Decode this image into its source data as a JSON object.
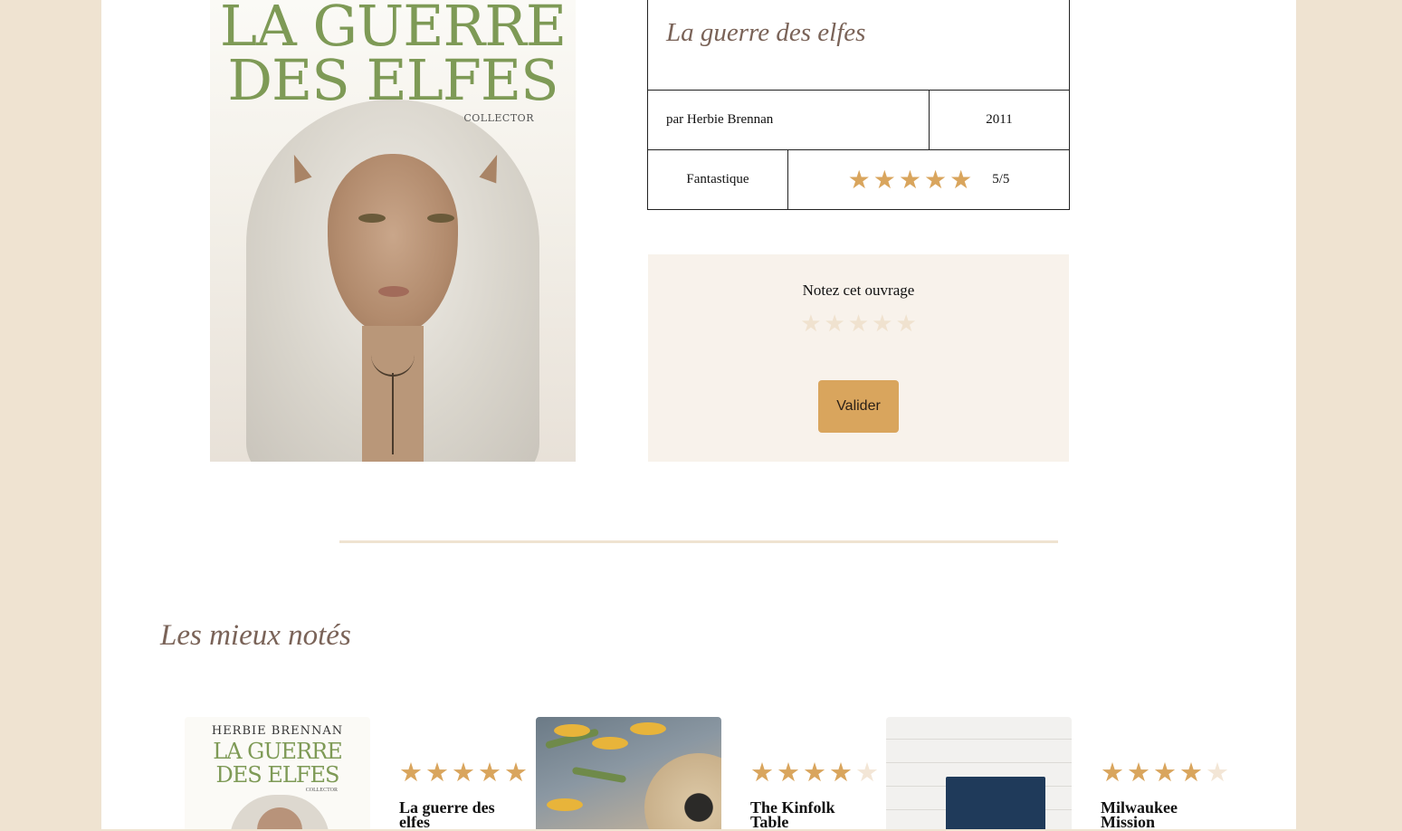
{
  "book": {
    "cover": {
      "title_line1": "LA GUERRE",
      "title_line2": "DES ELFES",
      "edition": "COLLECTOR"
    },
    "title": "La guerre des elfes",
    "author": "par Herbie Brennan",
    "year": "2011",
    "genre": "Fantastique",
    "rating": 5,
    "rating_max": 5,
    "rating_text": "5/5"
  },
  "rate_form": {
    "label": "Notez cet ouvrage",
    "selected": 0,
    "max": 5,
    "submit_label": "Valider"
  },
  "top_rated": {
    "heading": "Les mieux notés",
    "cards": [
      {
        "title": "La guerre des elfes",
        "rating": 5,
        "cover_author": "HERBIE BRENNAN",
        "cover_line1": "LA GUERRE",
        "cover_line2": "DES ELFES",
        "cover_edition": "COLLECTOR"
      },
      {
        "title": "The Kinfolk Table",
        "rating": 4
      },
      {
        "title": "Milwaukee Mission",
        "rating": 4
      }
    ]
  },
  "colors": {
    "page_bg": "#efe3d1",
    "accent_gold": "#d9a55d",
    "heading_brown": "#7a6358",
    "star_pale": "#f3e6d6",
    "rate_box_bg": "#f8f2eb"
  }
}
